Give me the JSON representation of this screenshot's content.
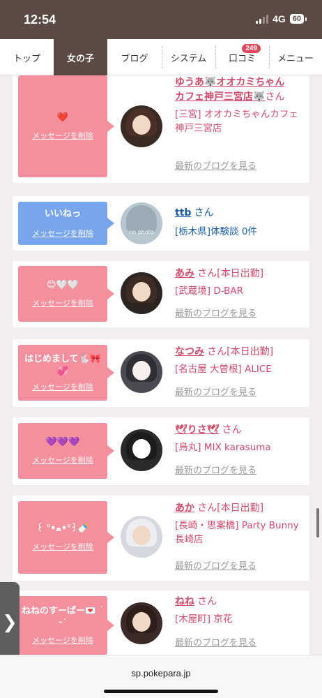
{
  "status": {
    "time": "12:54",
    "network": "4G",
    "battery": "60"
  },
  "nav": {
    "tabs": [
      {
        "label": "トップ"
      },
      {
        "label": "女の子"
      },
      {
        "label": "ブログ"
      },
      {
        "label": "システム"
      },
      {
        "label": "口コミ",
        "badge": "249"
      },
      {
        "label": "メニュー"
      }
    ]
  },
  "common": {
    "delete_label": "メッセージを削除",
    "blog_label": "最新のブログを見る",
    "san": "さん"
  },
  "cards": [
    {
      "message": "❤️",
      "name_line1": "ゆうあ🐺オオカミちゃん",
      "name_line2": "カフェ神戸三宮店🐺",
      "san": "さん",
      "shop": "[三宮] オオカミちゃんカフェ神戸三宮店",
      "blog": "最新のブログを見る"
    },
    {
      "message": "いいねっ",
      "name": "ttb",
      "san": "さん",
      "shop": "[栃木県]体験談 0件",
      "avatar_text": "no photo"
    },
    {
      "message": "😊🤍🤍",
      "name": "あみ",
      "san": "さん[本日出勤]",
      "shop": "[武蔵境] D-BAR",
      "blog": "最新のブログを見る"
    },
    {
      "message": "はじめまして🐇🎀💞",
      "name": "なつみ",
      "san": "さん[本日出勤]",
      "shop": "[名古屋 大曽根] ALICE",
      "blog": "最新のブログを見る"
    },
    {
      "message": "💜💜💜",
      "name": "🕊りさ🕊",
      "san": "さん",
      "shop": "[烏丸] MIX karasuma",
      "blog": "最新のブログを見る"
    },
    {
      "message": "꒰ ᐡ•ﻌ•ᐡ꒱🍼",
      "name": "あか",
      "san": "さん[本日出勤]",
      "shop": "[長崎・思案橋] Party Bunny 長崎店",
      "blog": "最新のブログを見る"
    },
    {
      "message": "ねねのすーぱー💌 ˙ᵕ˙",
      "name": "ねね",
      "san": "さん",
      "shop": "[木屋町] 京花",
      "blog": "最新のブログを見る"
    }
  ],
  "side_handle": "❯",
  "browser": {
    "url": "sp.pokepara.jp"
  },
  "colors": {
    "header_brown": "#5a4a43",
    "bubble_pink": "#f4909d",
    "bubble_blue": "#79a5ec",
    "name_pink": "#d24a6a",
    "link_blue": "#1d5fa7"
  }
}
